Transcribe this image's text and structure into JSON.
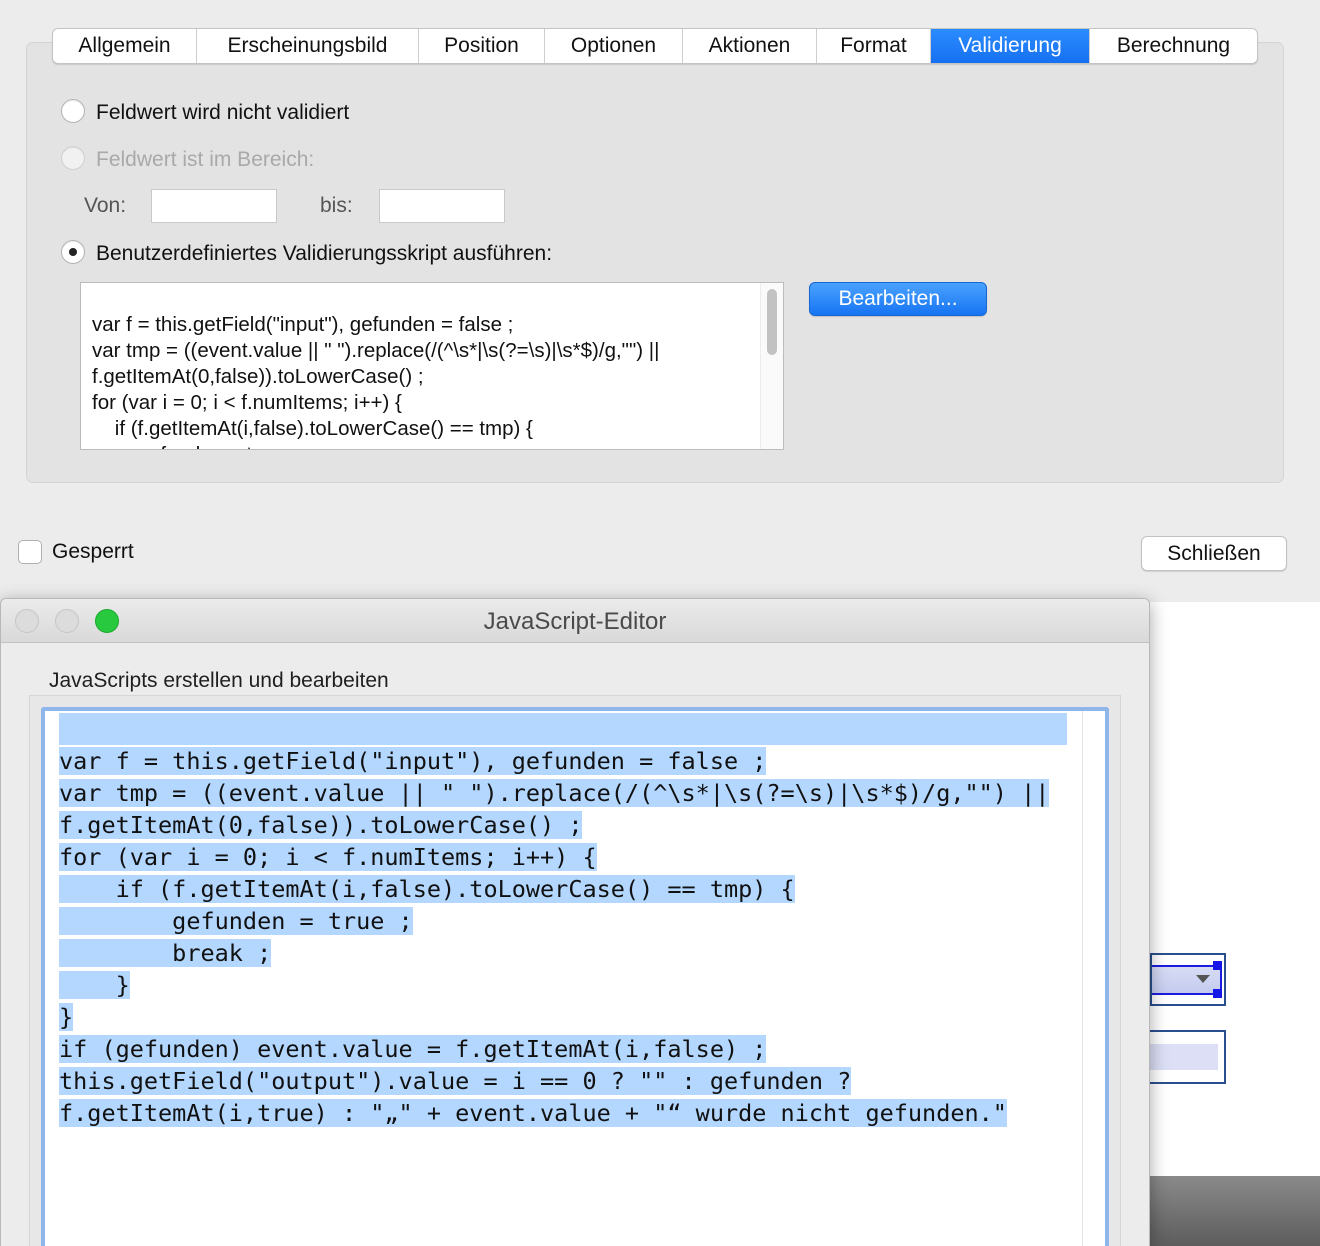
{
  "properties_dialog": {
    "tabs": [
      {
        "label": "Allgemein",
        "active": false
      },
      {
        "label": "Erscheinungsbild",
        "active": false
      },
      {
        "label": "Position",
        "active": false
      },
      {
        "label": "Optionen",
        "active": false
      },
      {
        "label": "Aktionen",
        "active": false
      },
      {
        "label": "Format",
        "active": false
      },
      {
        "label": "Validierung",
        "active": true
      },
      {
        "label": "Berechnung",
        "active": false
      }
    ],
    "validation": {
      "option_none": {
        "label": "Feldwert wird nicht validiert",
        "selected": false,
        "enabled": true
      },
      "option_range": {
        "label": "Feldwert ist im Bereich:",
        "selected": false,
        "enabled": false
      },
      "range_from_label": "Von:",
      "range_from_value": "",
      "range_to_label": "bis:",
      "range_to_value": "",
      "option_script": {
        "label": "Benutzerdefiniertes Validierungsskript ausführen:",
        "selected": true,
        "enabled": true
      },
      "script_preview": "var f = this.getField(\"input\"), gefunden = false ;\nvar tmp = ((event.value || \" \").replace(/(^\\s*|\\s(?=\\s)|\\s*$)/g,\"\") ||\nf.getItemAt(0,false)).toLowerCase() ;\nfor (var i = 0; i < f.numItems; i++) {\n    if (f.getItemAt(i,false).toLowerCase() == tmp) {\n        gefunden = true ;",
      "edit_button": "Bearbeiten..."
    },
    "locked_label": "Gesperrt",
    "locked_checked": false,
    "close_button": "Schließen"
  },
  "js_editor": {
    "title": "JavaScript-Editor",
    "heading": "JavaScripts erstellen und bearbeiten",
    "code_lines": [
      "",
      "var f = this.getField(\"input\"), gefunden = false ;",
      "var tmp = ((event.value || \" \").replace(/(^\\s*|\\s(?=\\s)|\\s*$)/g,\"\") ||",
      "f.getItemAt(0,false)).toLowerCase() ;",
      "for (var i = 0; i < f.numItems; i++) {",
      "    if (f.getItemAt(i,false).toLowerCase() == tmp) {",
      "        gefunden = true ;",
      "        break ;",
      "    }",
      "}",
      "if (gefunden) event.value = f.getItemAt(i,false) ;",
      "this.getField(\"output\").value = i == 0 ? \"\" : gefunden ?",
      "f.getItemAt(i,true) : \"„\" + event.value + \"“ wurde nicht gefunden.\""
    ],
    "selection_color": "#b3d7ff"
  },
  "colors": {
    "accent": "#1670f0",
    "window_zoom": "#28c93f"
  }
}
